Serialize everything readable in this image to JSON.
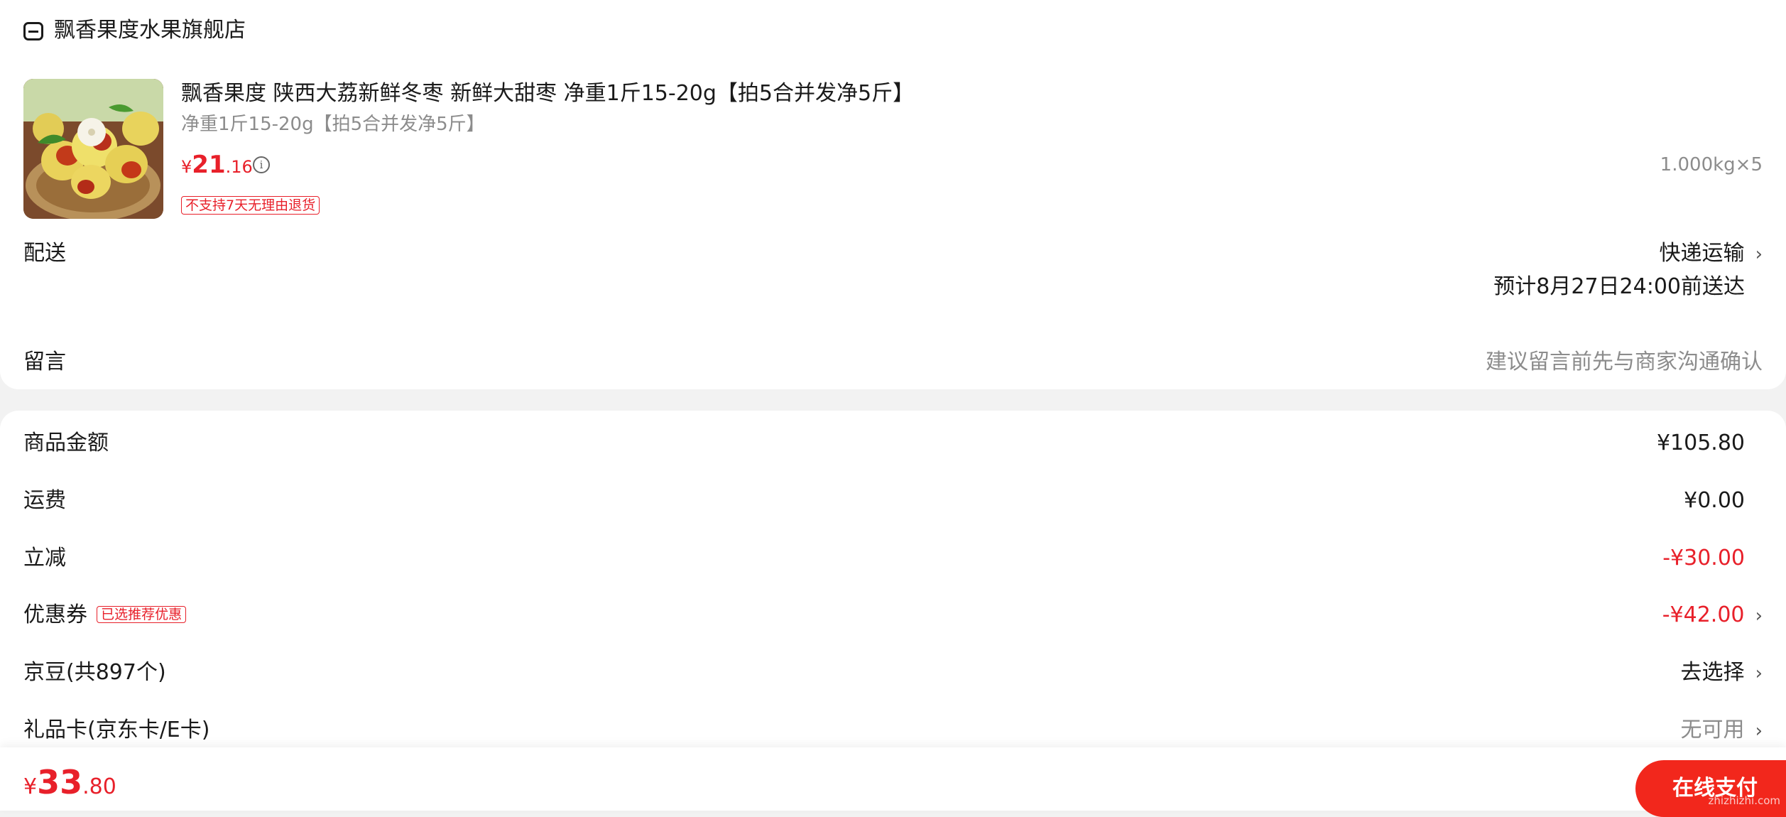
{
  "shop": {
    "icon": "store-icon",
    "name": "飘香果度水果旗舰店"
  },
  "product": {
    "title": "飘香果度 陕西大荔新鲜冬枣 新鲜大甜枣 净重1斤15-20g【拍5合并发净5斤】",
    "spec": "净重1斤15-20g【拍5合并发净5斤】",
    "price_symbol": "¥",
    "price_int": "21",
    "price_dec": ".16",
    "info_icon": "info-icon",
    "quantity": "1.000kg×5",
    "tag": "不支持7天无理由退货"
  },
  "delivery": {
    "label": "配送",
    "method": "快递运输",
    "eta": "预计8月27日24:00前送达"
  },
  "note": {
    "label": "留言",
    "placeholder": "建议留言前先与商家沟通确认"
  },
  "summary": {
    "goods_label": "商品金额",
    "goods_value": "¥105.80",
    "shipping_label": "运费",
    "shipping_value": "¥0.00",
    "discount_label": "立减",
    "discount_value": "-¥30.00",
    "coupon_label": "优惠券",
    "coupon_tag": "已选推荐优惠",
    "coupon_value": "-¥42.00",
    "beans_label": "京豆(共897个)",
    "beans_value": "去选择",
    "giftcard_label": "礼品卡(京东卡/E卡)",
    "giftcard_value": "无可用"
  },
  "bottom": {
    "total_symbol": "¥",
    "total_int": "33",
    "total_dec": ".80",
    "pay_label": "在线支付",
    "watermark": "zhizhizhi.com"
  },
  "colors": {
    "accent_red": "#e8202a",
    "pay_button": "#f2271c",
    "background": "#f2f2f2"
  }
}
